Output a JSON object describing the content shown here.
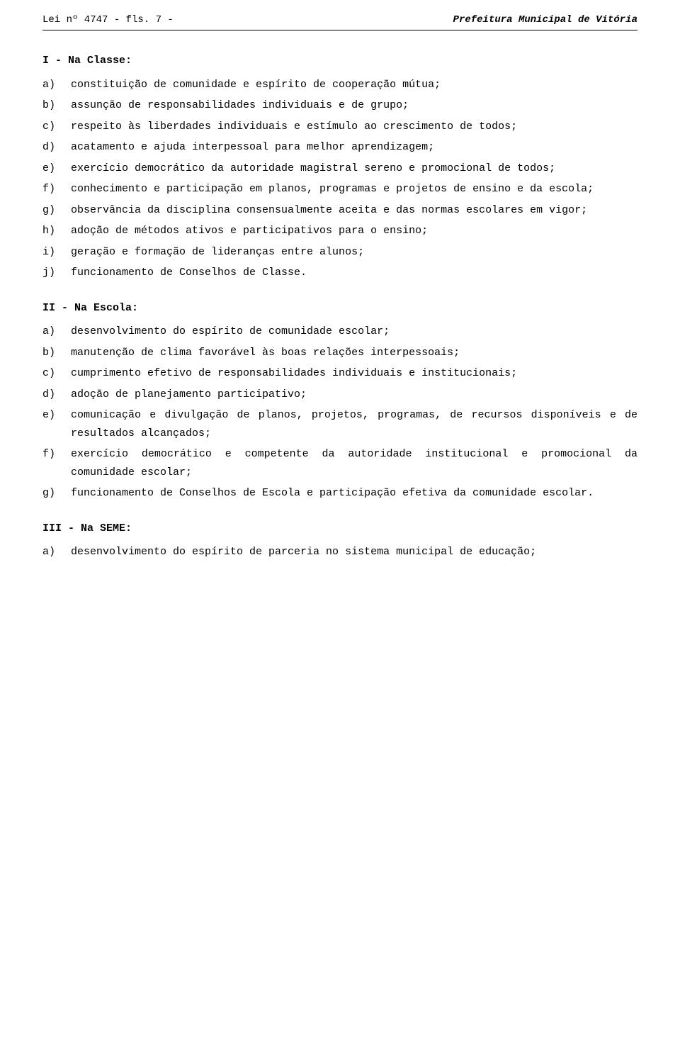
{
  "header": {
    "left": "Lei nº 4747 - fls. 7 -",
    "right": "Prefeitura Municipal de Vitória"
  },
  "section_I": {
    "title": "I - Na Classe:",
    "items": [
      {
        "label": "a)",
        "text": "constituição de comunidade e espírito de cooperação mútua;"
      },
      {
        "label": "b)",
        "text": "assunção de responsabilidades individuais e de grupo;"
      },
      {
        "label": "c)",
        "text": "respeito às liberdades individuais e estímulo ao crescimento de todos;"
      },
      {
        "label": "d)",
        "text": "acatamento e ajuda interpessoal para melhor aprendizagem;"
      },
      {
        "label": "e)",
        "text": "exercício democrático da autoridade magistral sereno e promocional de todos;"
      },
      {
        "label": "f)",
        "text": "conhecimento e participação em planos, programas e projetos de ensino e da escola;"
      },
      {
        "label": "g)",
        "text": "observância da disciplina consensualmente aceita e das normas escolares em vigor;"
      },
      {
        "label": "h)",
        "text": "adoção de métodos ativos e participativos para o ensino;"
      },
      {
        "label": "i)",
        "text": "geração e formação de lideranças entre alunos;"
      },
      {
        "label": "j)",
        "text": "funcionamento de Conselhos de Classe."
      }
    ]
  },
  "section_II": {
    "title": "II - Na Escola:",
    "items": [
      {
        "label": "a)",
        "text": "desenvolvimento do espírito de comunidade escolar;"
      },
      {
        "label": "b)",
        "text": "manutenção de clima favorável às boas relações interpessoais;"
      },
      {
        "label": "c)",
        "text": "cumprimento efetivo de responsabilidades individuais e institucionais;"
      },
      {
        "label": "d)",
        "text": "adoção de planejamento participativo;"
      },
      {
        "label": "e)",
        "text": "comunicação e divulgação de planos, projetos, programas, de recursos disponíveis e de resultados alcançados;"
      },
      {
        "label": "f)",
        "text": "exercício democrático e competente da autoridade institucional e promocional da comunidade escolar;"
      },
      {
        "label": "g)",
        "text": "funcionamento de Conselhos de Escola e participação efetiva da comunidade escolar."
      }
    ]
  },
  "section_III": {
    "title": "III - Na SEME:",
    "items": [
      {
        "label": "a)",
        "text": "desenvolvimento do espírito de parceria no sistema municipal de educação;"
      }
    ]
  }
}
